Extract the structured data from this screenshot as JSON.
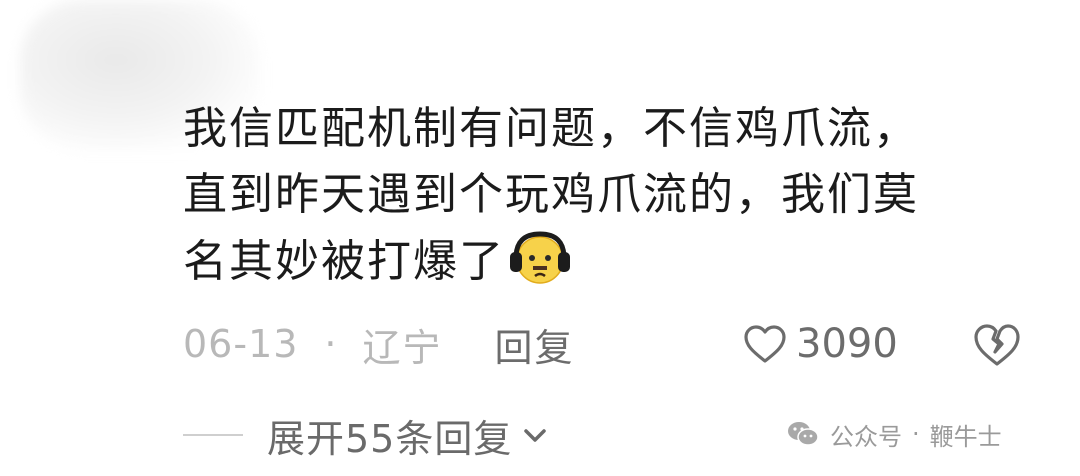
{
  "comment": {
    "lines": [
      "我信匹配机制有问题，不信鸡爪流，",
      "直到昨天遇到个玩鸡爪流的，我们莫",
      "名其妙被打爆了"
    ],
    "emoji_icon": "headphones-frown-emoji"
  },
  "meta": {
    "date": "06-13",
    "separator": "·",
    "location": "辽宁",
    "reply_label": "回复"
  },
  "actions": {
    "like_count": "3090",
    "like_icon": "heart-outline-icon",
    "dislike_icon": "broken-heart-icon"
  },
  "expand": {
    "label": "展开55条回复"
  },
  "watermark": {
    "prefix": "公众号",
    "separator": "·",
    "name": "鞭牛士"
  },
  "colors": {
    "text": "#1b1b1b",
    "meta": "#b8b8b8",
    "action": "#6c6c6c"
  }
}
